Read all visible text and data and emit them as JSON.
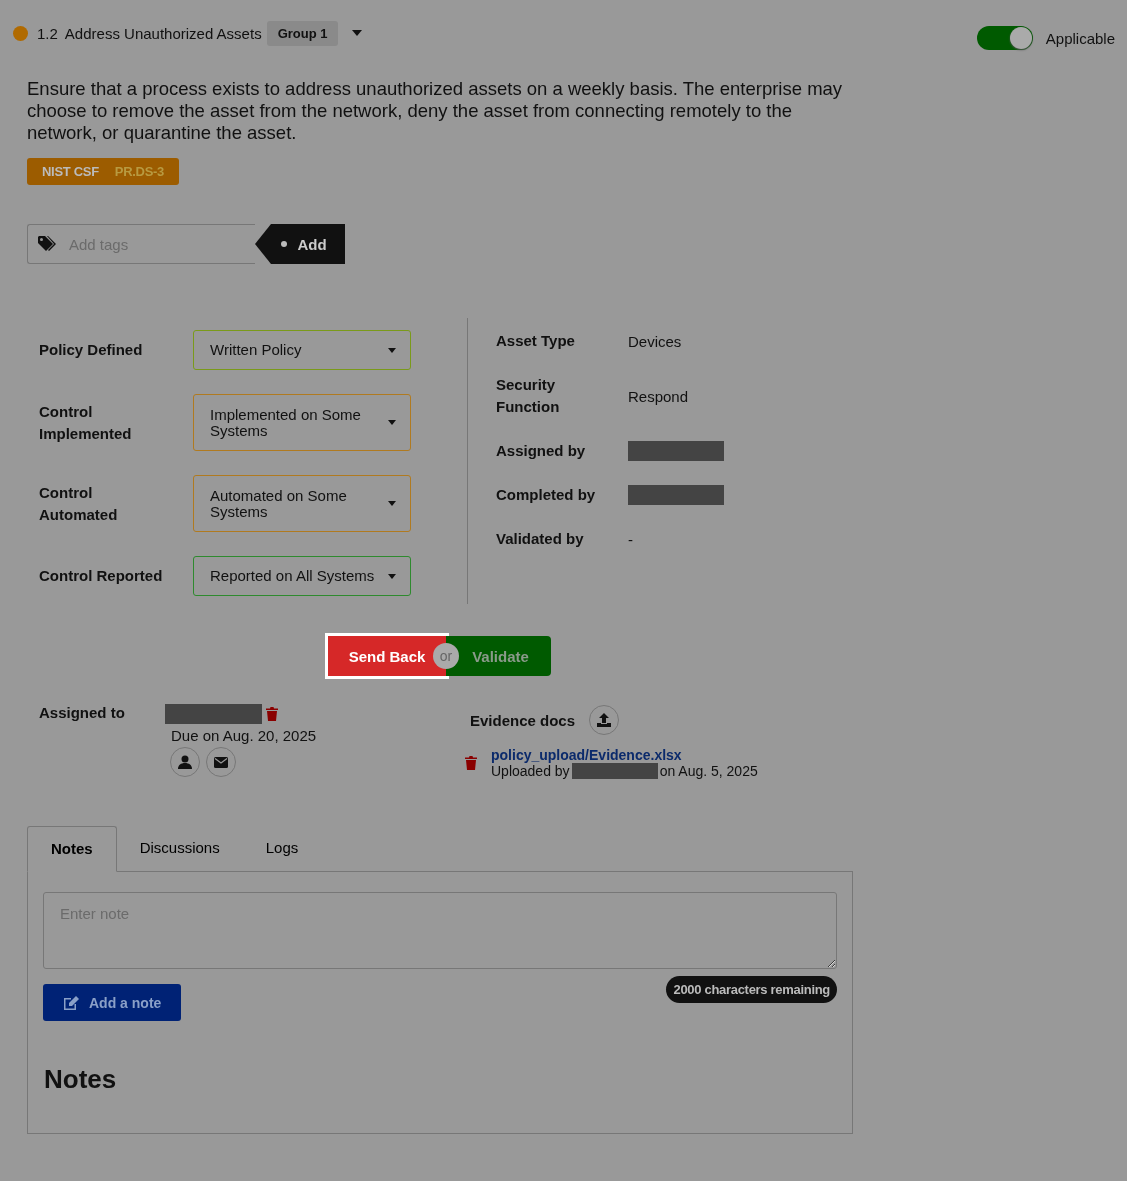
{
  "header": {
    "number": "1.2",
    "title": "Address Unauthorized Assets",
    "group": "Group 1",
    "applicable": {
      "label": "Applicable",
      "on": true
    }
  },
  "description": "Ensure that a process exists to address unauthorized assets on a weekly basis. The enterprise may choose to remove the asset from the network, deny the asset from connecting remotely to the network, or quarantine the asset.",
  "framework": {
    "name": "NIST CSF",
    "code": "PR.DS-3"
  },
  "tags": {
    "placeholder": "Add tags",
    "button": "Add"
  },
  "controls": [
    {
      "label": "Policy Defined",
      "value": "Written Policy",
      "color": "#7a9a1a"
    },
    {
      "label": "Control Implemented",
      "value": "Implemented on Some Systems",
      "color": "#b07a20"
    },
    {
      "label": "Control Automated",
      "value": "Automated on Some Systems",
      "color": "#b07a20"
    },
    {
      "label": "Control Reported",
      "value": "Reported on All Systems",
      "color": "#2e8a2e"
    }
  ],
  "details": [
    {
      "label": "Asset Type",
      "value": "Devices",
      "redacted": false
    },
    {
      "label": "Security Function",
      "value": "Respond",
      "redacted": false
    },
    {
      "label": "Assigned by",
      "redacted": true
    },
    {
      "label": "Completed by",
      "redacted": true
    },
    {
      "label": "Validated by",
      "value": "-",
      "redacted": false
    }
  ],
  "actions": {
    "send_back": "Send Back",
    "or": "or",
    "validate": "Validate",
    "highlighted": true
  },
  "assigned": {
    "label": "Assigned to",
    "redacted": true,
    "due": "Due on Aug. 20, 2025"
  },
  "evidence": {
    "label": "Evidence docs",
    "file": "policy_upload/Evidence.xlsx",
    "uploaded_prefix": "Uploaded by",
    "uploader_redacted": true,
    "uploaded_suffix": "on Aug. 5, 2025"
  },
  "tabs": [
    {
      "label": "Notes",
      "selected": true
    },
    {
      "label": "Discussions",
      "selected": false
    },
    {
      "label": "Logs",
      "selected": false
    }
  ],
  "note": {
    "placeholder": "Enter note",
    "button": "Add a note",
    "counter": "2000 characters remaining",
    "heading": "Notes"
  }
}
